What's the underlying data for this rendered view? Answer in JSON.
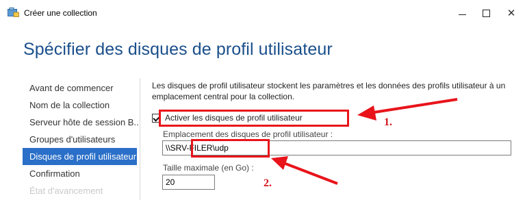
{
  "window": {
    "title": "Créer une collection",
    "app_icon": "server-collection-icon",
    "controls": {
      "minimize": "minimize-icon",
      "maximize": "maximize-icon",
      "close": "close-icon",
      "close_glyph": "✕"
    }
  },
  "page": {
    "title": "Spécifier des disques de profil utilisateur"
  },
  "nav": {
    "items": [
      {
        "label": "Avant de commencer",
        "state": "normal"
      },
      {
        "label": "Nom de la collection",
        "state": "normal"
      },
      {
        "label": "Serveur hôte de session B...",
        "state": "normal"
      },
      {
        "label": "Groupes d'utilisateurs",
        "state": "normal"
      },
      {
        "label": "Disques de profil utilisateur",
        "state": "active"
      },
      {
        "label": "Confirmation",
        "state": "normal"
      },
      {
        "label": "État d'avancement",
        "state": "disabled"
      }
    ]
  },
  "content": {
    "description": "Les disques de profil utilisateur stockent les paramètres et les données des profils utilisateur à un emplacement central pour la collection.",
    "enable_checkbox": {
      "label": "Activer les disques de profil utilisateur",
      "checked": true
    },
    "location": {
      "label": "Emplacement des disques de profil utilisateur :",
      "value": "\\\\SRV-FILER\\udp"
    },
    "max_size": {
      "label": "Taille maximale (en Go) :",
      "value": "20"
    }
  },
  "annotations": {
    "step1": "1.",
    "step2": "2.",
    "color": "#e8141a"
  },
  "colors": {
    "title": "#1a4f8b",
    "nav_active_bg": "#2a6fc8",
    "nav_disabled": "#c9c9c9"
  }
}
